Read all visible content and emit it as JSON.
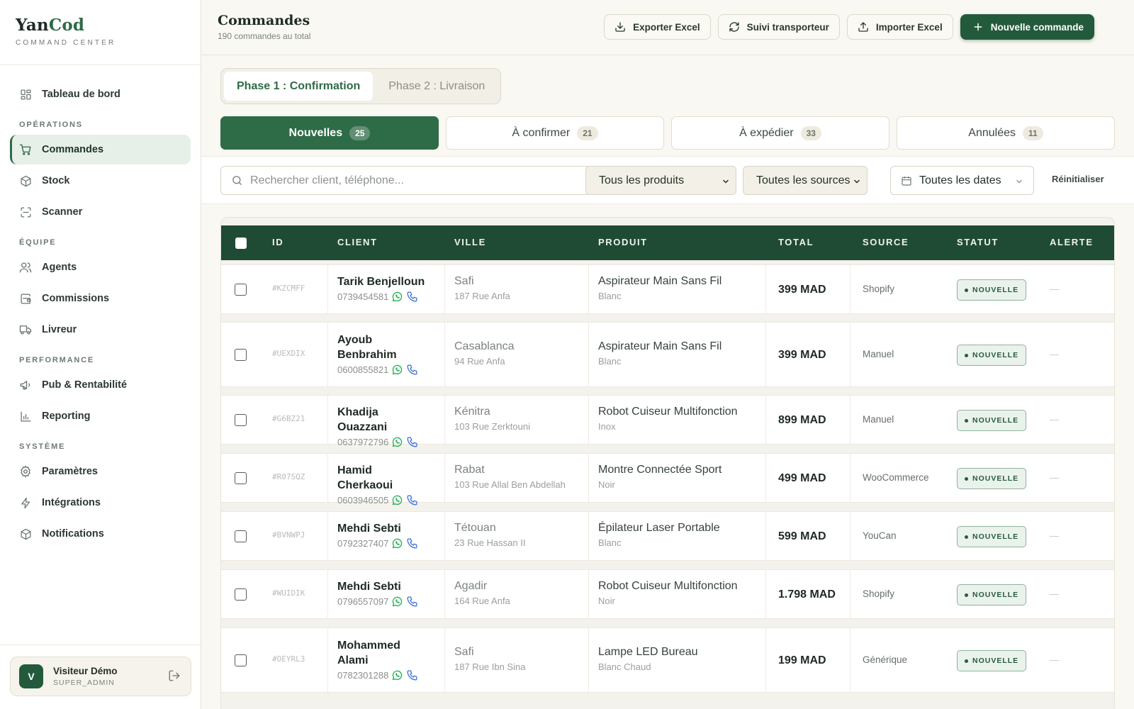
{
  "brand": {
    "name_a": "Yan",
    "name_b": "Cod",
    "subtitle": "COMMAND CENTER"
  },
  "sidebar": {
    "top_item": {
      "label": "Tableau de bord",
      "icon": "dashboard-icon"
    },
    "sections": [
      {
        "title": "OPÉRATIONS",
        "items": [
          {
            "label": "Commandes",
            "icon": "cart-icon",
            "active": true
          },
          {
            "label": "Stock",
            "icon": "box-icon"
          },
          {
            "label": "Scanner",
            "icon": "scan-icon"
          }
        ]
      },
      {
        "title": "ÉQUIPE",
        "items": [
          {
            "label": "Agents",
            "icon": "users-icon"
          },
          {
            "label": "Commissions",
            "icon": "wallet-icon"
          },
          {
            "label": "Livreur",
            "icon": "truck-icon"
          }
        ]
      },
      {
        "title": "PERFORMANCE",
        "items": [
          {
            "label": "Pub & Rentabilité",
            "icon": "megaphone-icon"
          },
          {
            "label": "Reporting",
            "icon": "bar-chart-icon"
          }
        ]
      },
      {
        "title": "SYSTÈME",
        "items": [
          {
            "label": "Paramètres",
            "icon": "gear-icon"
          },
          {
            "label": "Intégrations",
            "icon": "bolt-icon"
          },
          {
            "label": "Notifications",
            "icon": "bell-box-icon"
          }
        ]
      }
    ],
    "user": {
      "initial": "V",
      "name": "Visiteur Démo",
      "role": "SUPER_ADMIN"
    }
  },
  "header": {
    "title": "Commandes",
    "subtitle": "190 commandes au total",
    "actions": {
      "export": "Exporter Excel",
      "tracking": "Suivi transporteur",
      "import": "Importer Excel",
      "new": "Nouvelle commande"
    }
  },
  "phases": {
    "phase1": "Phase 1 : Confirmation",
    "phase2": "Phase 2 : Livraison"
  },
  "status_tabs": [
    {
      "label": "Nouvelles",
      "count": "25",
      "active": true
    },
    {
      "label": "À confirmer",
      "count": "21"
    },
    {
      "label": "À expédier",
      "count": "33"
    },
    {
      "label": "Annulées",
      "count": "11"
    }
  ],
  "filters": {
    "search_placeholder": "Rechercher client, téléphone...",
    "products": "Tous les produits",
    "sources": "Toutes les sources",
    "dates": "Toutes les dates",
    "reset": "Réinitialiser"
  },
  "table": {
    "headers": {
      "id": "ID",
      "client": "CLIENT",
      "ville": "VILLE",
      "produit": "PRODUIT",
      "total": "TOTAL",
      "source": "SOURCE",
      "statut": "STATUT",
      "alerte": "ALERTE"
    },
    "rows": [
      {
        "id": "#KZCMFF",
        "client": "Tarik Benjelloun",
        "phone": "0739454581",
        "city": "Safi",
        "address": "187 Rue Anfa",
        "product": "Aspirateur Main Sans Fil",
        "variant": "Blanc",
        "total": "399 MAD",
        "source": "Shopify",
        "status": "NOUVELLE",
        "alert": "—"
      },
      {
        "id": "#UEXDIX",
        "client": "Ayoub Benbrahim",
        "phone": "0600855821",
        "city": "Casablanca",
        "address": "94 Rue Anfa",
        "product": "Aspirateur Main Sans Fil",
        "variant": "Blanc",
        "total": "399 MAD",
        "source": "Manuel",
        "status": "NOUVELLE",
        "alert": "—"
      },
      {
        "id": "#G6BZ21",
        "client": "Khadija Ouazzani",
        "phone": "0637972796",
        "city": "Kénitra",
        "address": "103 Rue Zerktouni",
        "product": "Robot Cuiseur Multifonction",
        "variant": "Inox",
        "total": "899 MAD",
        "source": "Manuel",
        "status": "NOUVELLE",
        "alert": "—"
      },
      {
        "id": "#R07SQZ",
        "client": "Hamid Cherkaoui",
        "phone": "0603946505",
        "city": "Rabat",
        "address": "103 Rue Allal Ben Abdellah",
        "product": "Montre Connectée Sport",
        "variant": "Noir",
        "total": "499 MAD",
        "source": "WooCommerce",
        "status": "NOUVELLE",
        "alert": "—"
      },
      {
        "id": "#BVNWPJ",
        "client": "Mehdi Sebti",
        "phone": "0792327407",
        "city": "Tétouan",
        "address": "23 Rue Hassan II",
        "product": "Épilateur Laser Portable",
        "variant": "Blanc",
        "total": "599 MAD",
        "source": "YouCan",
        "status": "NOUVELLE",
        "alert": "—"
      },
      {
        "id": "#WUIDIK",
        "client": "Mehdi Sebti",
        "phone": "0796557097",
        "city": "Agadir",
        "address": "164 Rue Anfa",
        "product": "Robot Cuiseur Multifonction",
        "variant": "Noir",
        "total": "1.798 MAD",
        "source": "Shopify",
        "status": "NOUVELLE",
        "alert": "—"
      },
      {
        "id": "#OEYRL3",
        "client": "Mohammed Alami",
        "phone": "0782301288",
        "city": "Safi",
        "address": "187 Rue Ibn Sina",
        "product": "Lampe LED Bureau",
        "variant": "Blanc Chaud",
        "total": "199 MAD",
        "source": "Générique",
        "status": "NOUVELLE",
        "alert": "—"
      }
    ]
  },
  "colors": {
    "brand_green": "#235a3b",
    "accent_green": "#2e6b47",
    "header_green": "#1f4b34",
    "background": "#faf8f3"
  }
}
